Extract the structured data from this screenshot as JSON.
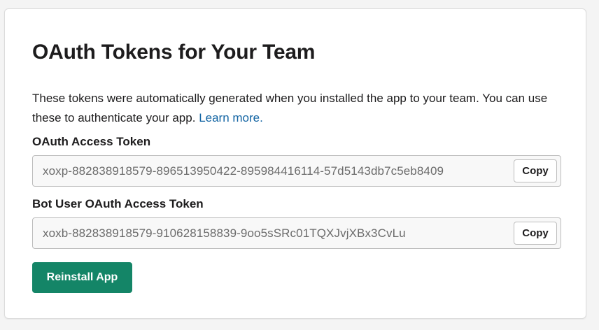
{
  "card": {
    "title": "OAuth Tokens for Your Team",
    "description": "These tokens were automatically generated when you installed the app to your team. You can use these to authenticate your app.",
    "learn_more": "Learn more."
  },
  "oauth_token": {
    "label": "OAuth Access Token",
    "value": "xoxp-882838918579-896513950422-895984416114-57d5143db7c5eb8409",
    "copy_label": "Copy"
  },
  "bot_token": {
    "label": "Bot User OAuth Access Token",
    "value": "xoxb-882838918579-910628158839-9oo5sSRc01TQXJvjXBx3CvLu",
    "copy_label": "Copy"
  },
  "reinstall_label": "Reinstall App",
  "colors": {
    "primary_button": "#148567",
    "link": "#1264a3",
    "text": "#1d1c1d",
    "token_text": "#6b6b6b"
  }
}
